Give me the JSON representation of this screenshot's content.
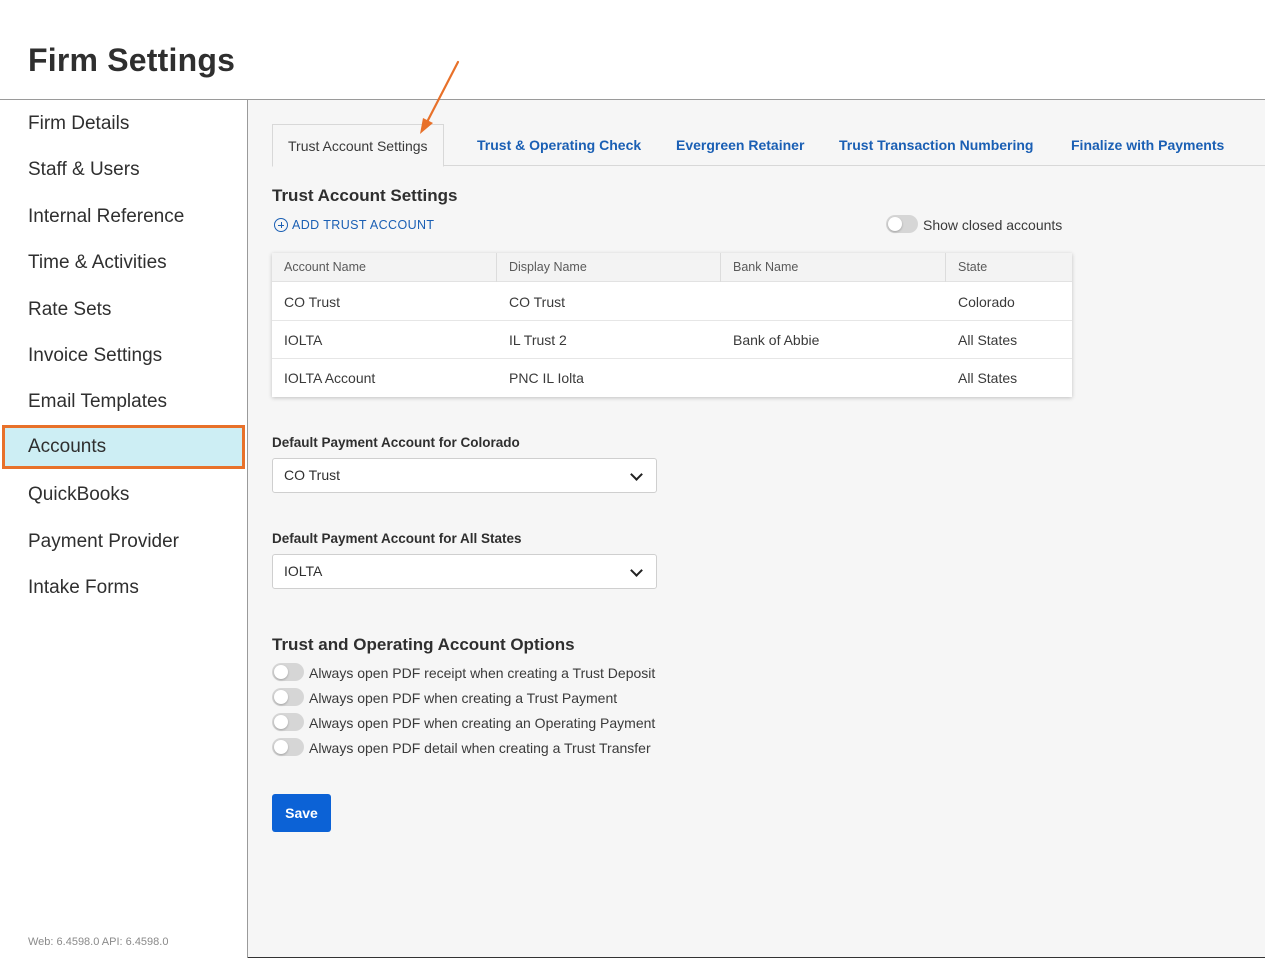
{
  "page": {
    "title": "Firm Settings"
  },
  "sidebar": {
    "items": [
      {
        "label": "Firm Details"
      },
      {
        "label": "Staff & Users"
      },
      {
        "label": "Internal Reference"
      },
      {
        "label": "Time & Activities"
      },
      {
        "label": "Rate Sets"
      },
      {
        "label": "Invoice Settings"
      },
      {
        "label": "Email Templates"
      },
      {
        "label": "Accounts"
      },
      {
        "label": "QuickBooks"
      },
      {
        "label": "Payment Provider"
      },
      {
        "label": "Intake Forms"
      }
    ],
    "active": "Accounts",
    "version": "Web: 6.4598.0 API: 6.4598.0"
  },
  "tabs": [
    {
      "label": "Trust Account Settings"
    },
    {
      "label": "Trust & Operating Check"
    },
    {
      "label": "Evergreen Retainer"
    },
    {
      "label": "Trust Transaction Numbering"
    },
    {
      "label": "Finalize with Payments"
    }
  ],
  "trust": {
    "heading": "Trust Account Settings",
    "add_label": "ADD TRUST ACCOUNT",
    "show_closed_label": "Show closed accounts",
    "show_closed_on": false,
    "columns": [
      "Account Name",
      "Display Name",
      "Bank Name",
      "State"
    ],
    "rows": [
      [
        "CO Trust",
        "CO Trust",
        "",
        "Colorado"
      ],
      [
        "IOLTA",
        "IL Trust 2",
        "Bank of Abbie",
        "All States"
      ],
      [
        "IOLTA Account",
        "PNC IL Iolta",
        "",
        "All States"
      ]
    ]
  },
  "defaults": {
    "colorado_label": "Default Payment Account for Colorado",
    "colorado_value": "CO Trust",
    "all_states_label": "Default Payment Account for All States",
    "all_states_value": "IOLTA"
  },
  "options": {
    "heading": "Trust and Operating Account Options",
    "items": [
      {
        "label": "Always open PDF receipt when creating a Trust Deposit",
        "on": false
      },
      {
        "label": "Always open PDF when creating a Trust Payment",
        "on": false
      },
      {
        "label": "Always open PDF when creating an Operating Payment",
        "on": false
      },
      {
        "label": "Always open PDF detail when creating a Trust Transfer",
        "on": false
      }
    ]
  },
  "save_label": "Save",
  "colors": {
    "accent": "#0c62d6",
    "link": "#1a5fb4",
    "highlight_border": "#e8712a",
    "highlight_bg": "#cdeef4"
  }
}
